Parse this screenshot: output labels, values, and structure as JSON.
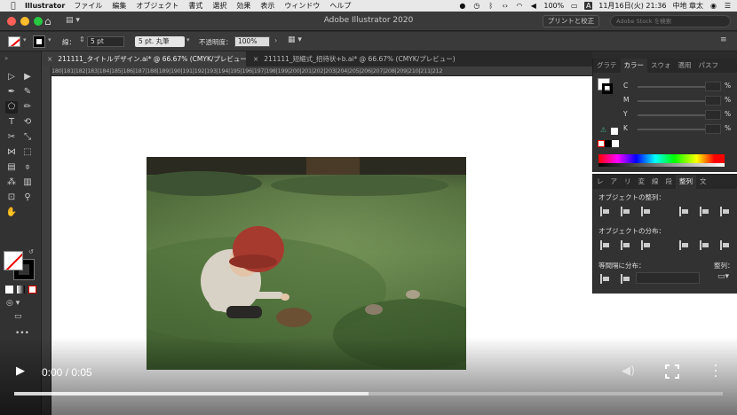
{
  "menubar": {
    "app_name": "Illustrator",
    "items": [
      "ファイル",
      "編集",
      "オブジェクト",
      "書式",
      "選択",
      "効果",
      "表示",
      "ウィンドウ",
      "ヘルプ"
    ],
    "battery": "100%",
    "datetime": "11月16日(火)  21:36",
    "user": "中地 章太",
    "input_indicator": "A"
  },
  "titlebar": {
    "title": "Adobe Illustrator 2020",
    "print_button": "プリントと校正",
    "stock_placeholder": "Adobe Stock を検索"
  },
  "controlbar": {
    "stroke_label": "線：",
    "stroke_value": "5 pt",
    "brush_value": "5 pt. 丸筆",
    "opacity_label": "不透明度：",
    "opacity_value": "100%"
  },
  "tabs": [
    {
      "label": "211111_タイトルデザイン.ai* @ 66.67% (CMYK/プレビュー)",
      "active": true
    },
    {
      "label": "211111_短縮式_招待状+b.ai* @ 66.67% (CMYK/プレビュー)",
      "active": false
    }
  ],
  "ruler_text": "180|181|182|183|184|185|186|187|188|189|190|191|192|193|194|195|196|197|198|199|200|201|202|203|204|205|206|207|208|209|210|211|212",
  "color_panel": {
    "tabs": [
      "グラテ",
      "カラー",
      "スウォ",
      "適用",
      "パスフ"
    ],
    "active_tab": "カラー",
    "channels": [
      "C",
      "M",
      "Y",
      "K"
    ],
    "percent": "%"
  },
  "align_panel": {
    "tabs": [
      "レ",
      "ア",
      "リ",
      "変",
      "線",
      "段",
      "整列",
      "文"
    ],
    "active_tab": "整列",
    "align_objects": "オブジェクトの整列：",
    "distribute_objects": "オブジェクトの分布：",
    "distribute_spacing": "等間隔に分布：",
    "align_to": "整列："
  },
  "video": {
    "time": "0:00 / 0:05",
    "loaded_fraction": 0.5
  }
}
